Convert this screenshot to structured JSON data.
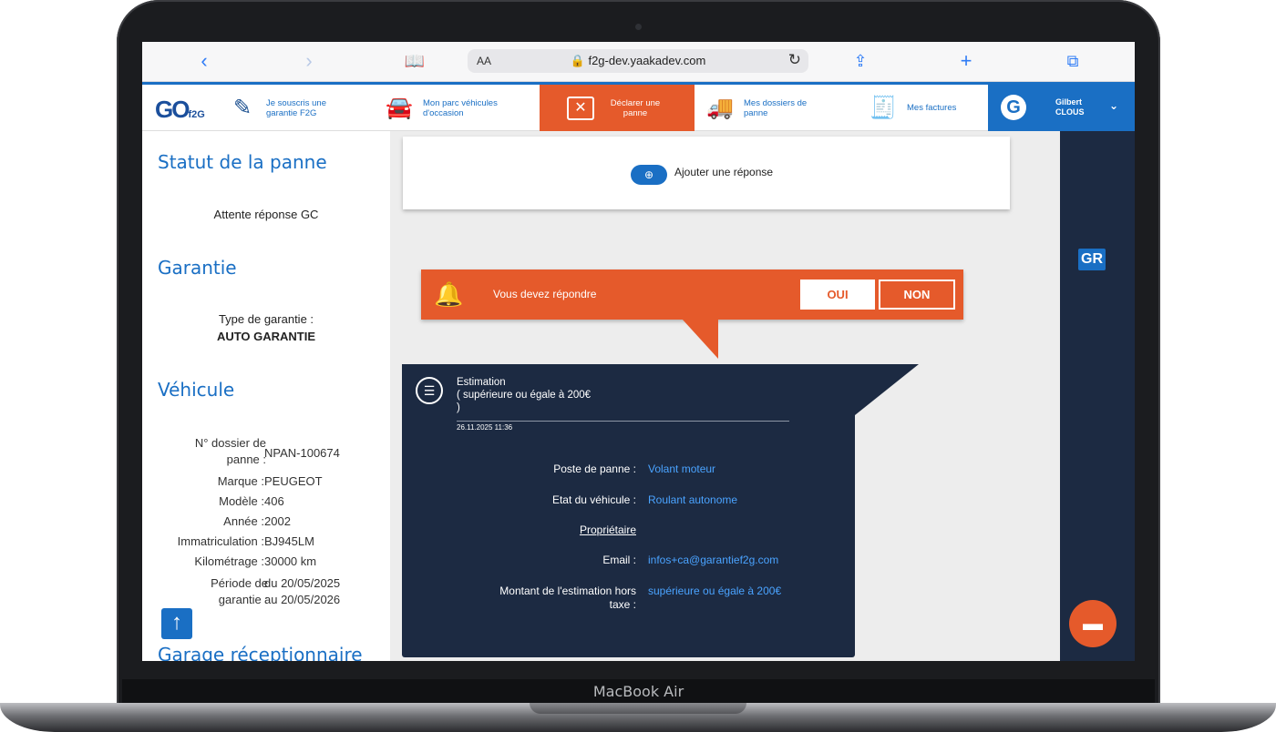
{
  "device": {
    "label": "MacBook Air"
  },
  "browser": {
    "font_size_label": "AA",
    "url": "🔒 f2g-dev.yaakadev.com",
    "icons": [
      "back-icon",
      "forward-icon",
      "bookmarks-icon",
      "reload-icon",
      "share-icon",
      "new-tab-icon",
      "tabs-icon"
    ]
  },
  "nav": {
    "logo": "GO",
    "logo_sub": "f2G",
    "items": [
      {
        "label": "Je souscris une garantie F2G",
        "icon": "contract-icon"
      },
      {
        "label": "Mon parc véhicules d'occasion",
        "icon": "car-icon"
      },
      {
        "label": "Déclarer une panne",
        "icon": "tools-icon"
      },
      {
        "label": "Mes dossiers de panne",
        "icon": "tow-truck-icon"
      },
      {
        "label": "Mes factures",
        "icon": "invoice-icon"
      }
    ],
    "active_index": 2,
    "user": {
      "first": "Gilbert",
      "last": "CLOUS"
    }
  },
  "left": {
    "status_title": "Statut de la panne",
    "status_value": "Attente réponse GC",
    "garantie_title": "Garantie",
    "garantie_type_label": "Type de garantie :",
    "garantie_type_value": "AUTO GARANTIE",
    "vehicule_title": "Véhicule",
    "fields": [
      {
        "k": "N° dossier de panne :",
        "v": "NPAN-100674"
      },
      {
        "k": "Marque :",
        "v": "PEUGEOT"
      },
      {
        "k": "Modèle :",
        "v": "406"
      },
      {
        "k": "Année :",
        "v": "2002"
      },
      {
        "k": "Immatriculation :",
        "v": "BJ945LM"
      },
      {
        "k": "Kilométrage :",
        "v": "30000 km"
      },
      {
        "k": "Période de garantie :",
        "v": "du 20/05/2025 au 20/05/2026"
      }
    ],
    "next_title": "Garage réceptionnaire"
  },
  "main": {
    "add_response": "Ajouter une réponse",
    "alert": {
      "text": "Vous devez répondre",
      "yes": "OUI",
      "no": "NON"
    },
    "estimation": {
      "title": "Estimation",
      "subtitle": "( supérieure ou égale à 200€",
      "close_paren": ")",
      "date": "26.11.2025 11:36",
      "rows": [
        {
          "label": "Poste de panne :",
          "value": "Volant moteur"
        },
        {
          "label": "Etat du véhicule :",
          "value": "Roulant autonome"
        },
        {
          "label": "Propriétaire",
          "value": ""
        },
        {
          "label": "Email :",
          "value": "infos+ca@garantief2g.com"
        },
        {
          "label": "Montant de l'estimation hors taxe :",
          "value": "supérieure ou égale à 200€"
        }
      ]
    }
  },
  "right": {
    "badge": "GR"
  },
  "colors": {
    "primary": "#1a6fc4",
    "accent": "#e55a2b",
    "dark": "#1c2a42"
  }
}
